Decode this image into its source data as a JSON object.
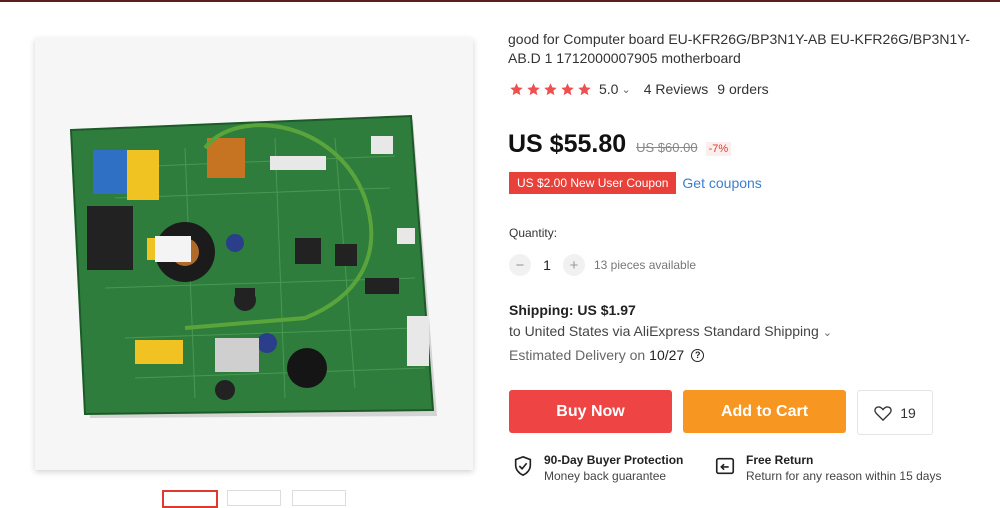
{
  "product": {
    "title": "good for Computer board EU-KFR26G/BP3N1Y-AB EU-KFR26G/BP3N1Y-AB.D 1 1712000007905 motherboard",
    "rating_value": "5.0",
    "rating_stars": 5,
    "reviews": "4 Reviews",
    "orders": "9 orders"
  },
  "price": {
    "current": "US $55.80",
    "original": "US $60.00",
    "discount": "-7%"
  },
  "coupon": {
    "label": "US $2.00 New User Coupon",
    "link": "Get coupons"
  },
  "quantity": {
    "label": "Quantity:",
    "minus": "−",
    "plus": "+",
    "value": "1",
    "available": "13 pieces available"
  },
  "shipping": {
    "title": "Shipping: US $1.97",
    "line": "to United States via AliExpress Standard Shipping",
    "delivery_prefix": "Estimated Delivery on",
    "delivery_date": "10/27"
  },
  "actions": {
    "buy_now": "Buy Now",
    "add_to_cart": "Add to Cart",
    "wishlist_count": "19"
  },
  "guarantees": [
    {
      "title": "90-Day Buyer Protection",
      "subtitle": "Money back guarantee",
      "icon": "shield-check-icon"
    },
    {
      "title": "Free Return",
      "subtitle": "Return for any reason within 15 days",
      "icon": "return-icon"
    }
  ],
  "colors": {
    "buy_now": "#ee4444",
    "add_to_cart": "#f79621",
    "coupon": "#e8413a",
    "star": "#f04f4f",
    "link": "#3a7fd0"
  },
  "images": {
    "main_icon": "circuit-board-photo",
    "thumbnail_count": 3
  }
}
